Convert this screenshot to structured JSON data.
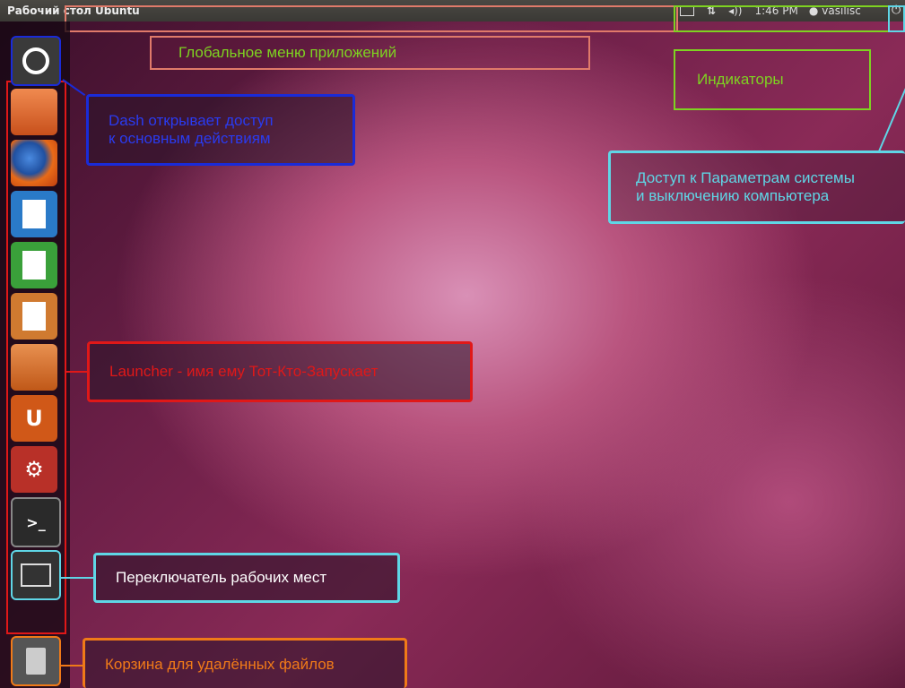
{
  "panel": {
    "title": "Рабочий стол Ubuntu",
    "clock": "1:46 PM",
    "user": "vasilisc"
  },
  "annotations": {
    "global_menu": "Глобальное меню приложений",
    "indicators": "Индикаторы",
    "dash": [
      "Dash открывает доступ",
      "к основным действиям"
    ],
    "system": [
      "Доступ к Параметрам системы",
      "и выключению компьютера"
    ],
    "launcher": "Launcher - имя ему Тот-Кто-Запускает",
    "workspaces": "Переключатель рабочих мест",
    "trash": "Корзина для удалённых файлов"
  },
  "colors": {
    "menu_green": "#7ed321",
    "dash_blue": "#1a2bd8",
    "cyan": "#5fd6e6",
    "launcher_red": "#e01818",
    "trash_orange": "#f07a18",
    "salmon": "#e07a6a"
  },
  "icons": [
    "dash-icon",
    "files-icon",
    "firefox-icon",
    "writer-icon",
    "calc-icon",
    "impress-icon",
    "software-center-icon",
    "ubuntu-one-icon",
    "system-settings-icon",
    "terminal-icon",
    "workspace-switcher-icon",
    "trash-icon"
  ]
}
